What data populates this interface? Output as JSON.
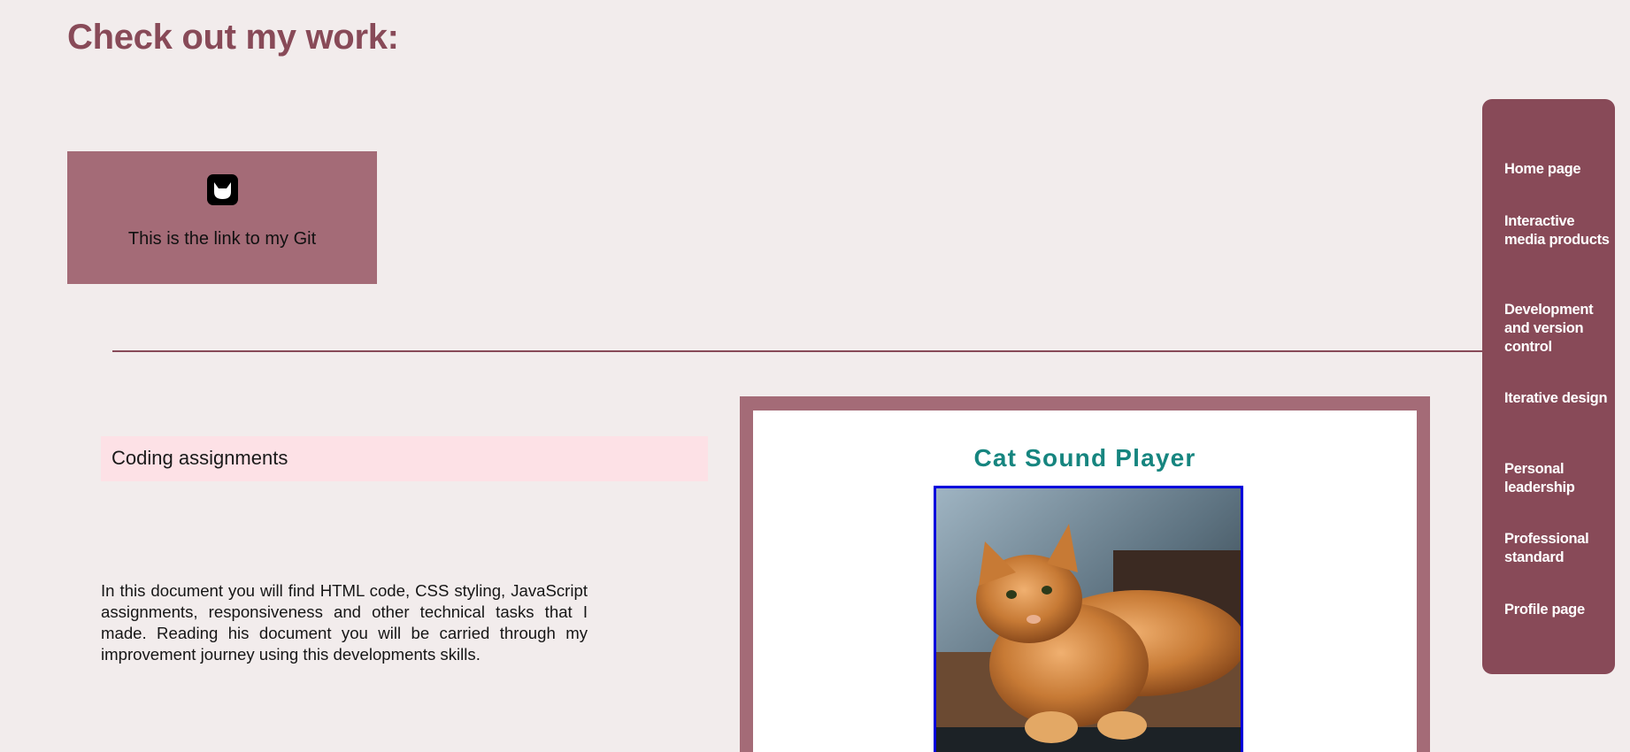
{
  "page": {
    "heading": "Check out my work:"
  },
  "git_card": {
    "icon": "gitlab-icon",
    "text": "This is the link to my Git"
  },
  "coding_section": {
    "title": "Coding assignments",
    "description": "In this document you will find HTML code, CSS styling, JavaScript assignments, responsiveness and other technical tasks that I made. Reading his document you will be carried through my improvement journey using this developments skills."
  },
  "preview": {
    "title": "Cat Sound Player",
    "image": "ginger-cat-photo"
  },
  "sidebar": {
    "items": [
      {
        "label": "Home page"
      },
      {
        "label": "Interactive media products"
      },
      {
        "label": "Development and version control"
      },
      {
        "label": "Iterative design"
      },
      {
        "label": "Personal leadership"
      },
      {
        "label": "Professional standard"
      },
      {
        "label": "Profile page"
      }
    ]
  },
  "colors": {
    "background": "#f2ecec",
    "accent": "#884a58",
    "card": "#a46b77",
    "section_title_bg": "#fde1e6",
    "preview_title": "#16857f",
    "image_border": "#0000dd"
  }
}
